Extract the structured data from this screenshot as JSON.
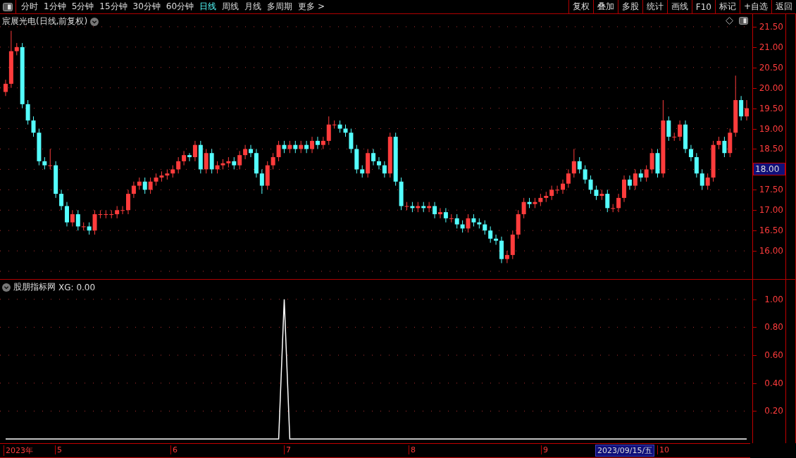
{
  "toolbar": {
    "periods": [
      {
        "label": "分时",
        "selected": false
      },
      {
        "label": "1分钟",
        "selected": false
      },
      {
        "label": "5分钟",
        "selected": false
      },
      {
        "label": "15分钟",
        "selected": false
      },
      {
        "label": "30分钟",
        "selected": false
      },
      {
        "label": "60分钟",
        "selected": false
      },
      {
        "label": "日线",
        "selected": true
      },
      {
        "label": "周线",
        "selected": false
      },
      {
        "label": "月线",
        "selected": false
      },
      {
        "label": "多周期",
        "selected": false
      },
      {
        "label": "更多 >",
        "selected": false
      }
    ],
    "buttons": [
      "复权",
      "叠加",
      "多股",
      "统计",
      "画线",
      "F10",
      "标记",
      "+自选",
      "返回"
    ]
  },
  "main_chart": {
    "title": "宸展光电(日线,前复权)",
    "current_price": "18.00",
    "chart_data": {
      "type": "candlestick",
      "grid": true,
      "ylim": [
        15.31,
        21.81
      ],
      "yticks": [
        {
          "value": 21.5,
          "label": "21.50"
        },
        {
          "value": 21,
          "label": "21.00"
        },
        {
          "value": 20.5,
          "label": "20.50"
        },
        {
          "value": 20,
          "label": "20.00"
        },
        {
          "value": 19.5,
          "label": "19.50"
        },
        {
          "value": 19,
          "label": "19.00"
        },
        {
          "value": 18.5,
          "label": "18.50"
        },
        {
          "value": 17.5,
          "label": "17.50"
        },
        {
          "value": 17,
          "label": "17.00"
        },
        {
          "value": 16.5,
          "label": "16.50"
        },
        {
          "value": 16,
          "label": "16.00"
        }
      ],
      "categories": [
        null,
        null,
        null,
        null,
        null,
        null,
        null,
        null,
        null,
        null,
        null,
        null,
        null,
        null,
        null,
        null,
        null,
        null,
        null,
        null,
        null,
        null,
        null,
        null,
        null,
        null,
        null,
        null,
        null,
        null,
        null,
        null,
        null,
        null,
        null,
        null,
        null,
        null,
        null,
        null,
        null,
        null,
        null,
        null,
        null,
        null,
        null,
        null,
        null,
        null,
        null,
        null,
        null,
        null,
        null,
        null,
        null,
        null,
        null,
        null,
        null,
        null,
        null,
        null,
        null,
        null,
        null,
        null,
        null,
        null,
        null,
        null,
        null,
        null,
        null,
        null,
        null,
        null,
        null,
        null,
        null,
        null,
        null,
        null,
        null,
        null,
        null,
        null,
        null,
        null,
        null,
        null,
        null,
        null,
        null,
        null,
        null,
        null,
        null,
        null,
        null,
        null,
        null,
        null,
        null,
        null,
        null,
        null,
        null,
        null,
        null,
        null,
        null,
        null,
        null,
        null,
        null,
        null,
        null,
        null,
        null,
        null,
        null,
        null,
        null,
        null,
        null,
        null,
        null,
        null,
        null,
        null,
        null,
        null
      ],
      "ohlc": [
        [
          19.9,
          20.2,
          19.8,
          20.1
        ],
        [
          20.1,
          21.4,
          20.0,
          20.9
        ],
        [
          20.9,
          21.1,
          20.8,
          21.0
        ],
        [
          21.0,
          21.1,
          19.5,
          19.6
        ],
        [
          19.6,
          19.7,
          19.1,
          19.2
        ],
        [
          19.2,
          19.3,
          18.8,
          18.9
        ],
        [
          18.9,
          19.0,
          18.1,
          18.2
        ],
        [
          18.2,
          18.3,
          18.0,
          18.1
        ],
        [
          18.1,
          18.5,
          18.0,
          18.1
        ],
        [
          18.1,
          18.2,
          17.3,
          17.4
        ],
        [
          17.4,
          17.5,
          17.0,
          17.1
        ],
        [
          17.1,
          17.2,
          16.6,
          16.7
        ],
        [
          16.7,
          17.0,
          16.6,
          16.9
        ],
        [
          16.9,
          17.0,
          16.5,
          16.6
        ],
        [
          16.6,
          16.7,
          16.5,
          16.6
        ],
        [
          16.6,
          16.7,
          16.4,
          16.5
        ],
        [
          16.5,
          17.0,
          16.4,
          16.9
        ],
        [
          16.9,
          17.0,
          16.8,
          16.9
        ],
        [
          16.9,
          17.0,
          16.8,
          16.9
        ],
        [
          16.9,
          17.0,
          16.8,
          16.9
        ],
        [
          16.9,
          17.1,
          16.8,
          17.0
        ],
        [
          17.0,
          17.1,
          16.9,
          17.0
        ],
        [
          17.0,
          17.5,
          16.9,
          17.4
        ],
        [
          17.4,
          17.7,
          17.3,
          17.6
        ],
        [
          17.6,
          17.8,
          17.5,
          17.7
        ],
        [
          17.7,
          17.8,
          17.4,
          17.5
        ],
        [
          17.5,
          17.8,
          17.4,
          17.7
        ],
        [
          17.7,
          17.9,
          17.6,
          17.8
        ],
        [
          17.8,
          17.95,
          17.7,
          17.85
        ],
        [
          17.85,
          18.0,
          17.75,
          17.9
        ],
        [
          17.9,
          18.1,
          17.8,
          18.0
        ],
        [
          18.0,
          18.3,
          17.9,
          18.2
        ],
        [
          18.2,
          18.45,
          18.1,
          18.35
        ],
        [
          18.35,
          18.4,
          18.2,
          18.3
        ],
        [
          18.3,
          18.7,
          18.2,
          18.6
        ],
        [
          18.6,
          18.7,
          17.9,
          18.0
        ],
        [
          18.0,
          18.5,
          17.9,
          18.4
        ],
        [
          18.4,
          18.5,
          17.9,
          18.0
        ],
        [
          18.0,
          18.2,
          17.9,
          18.1
        ],
        [
          18.1,
          18.25,
          18.0,
          18.15
        ],
        [
          18.15,
          18.3,
          18.05,
          18.2
        ],
        [
          18.2,
          18.3,
          18.0,
          18.1
        ],
        [
          18.1,
          18.45,
          18.0,
          18.35
        ],
        [
          18.35,
          18.6,
          18.25,
          18.5
        ],
        [
          18.5,
          18.6,
          18.3,
          18.4
        ],
        [
          18.4,
          18.5,
          17.8,
          17.9
        ],
        [
          17.9,
          18.0,
          17.4,
          17.6
        ],
        [
          17.6,
          18.2,
          17.5,
          18.1
        ],
        [
          18.1,
          18.4,
          18.0,
          18.3
        ],
        [
          18.3,
          18.7,
          18.2,
          18.6
        ],
        [
          18.6,
          18.7,
          18.4,
          18.5
        ],
        [
          18.5,
          18.7,
          18.4,
          18.6
        ],
        [
          18.6,
          18.7,
          18.4,
          18.5
        ],
        [
          18.5,
          18.7,
          18.4,
          18.6
        ],
        [
          18.6,
          18.7,
          18.4,
          18.5
        ],
        [
          18.5,
          18.8,
          18.4,
          18.7
        ],
        [
          18.7,
          18.8,
          18.5,
          18.6
        ],
        [
          18.6,
          18.8,
          18.5,
          18.7
        ],
        [
          18.7,
          19.3,
          18.6,
          19.1
        ],
        [
          19.1,
          19.2,
          19.0,
          19.1
        ],
        [
          19.1,
          19.2,
          18.9,
          19.0
        ],
        [
          19.0,
          19.1,
          18.8,
          18.9
        ],
        [
          18.9,
          19.0,
          18.4,
          18.5
        ],
        [
          18.5,
          18.6,
          17.9,
          18.0
        ],
        [
          18.0,
          18.1,
          17.8,
          17.9
        ],
        [
          17.9,
          18.5,
          17.8,
          18.4
        ],
        [
          18.4,
          18.5,
          18.1,
          18.2
        ],
        [
          18.2,
          18.3,
          18.0,
          18.1
        ],
        [
          18.1,
          18.2,
          17.8,
          17.9
        ],
        [
          17.9,
          18.9,
          17.8,
          18.8
        ],
        [
          18.8,
          18.9,
          17.6,
          17.7
        ],
        [
          17.7,
          17.8,
          17.0,
          17.1
        ],
        [
          17.1,
          17.2,
          17.0,
          17.1
        ],
        [
          17.1,
          17.2,
          16.95,
          17.05
        ],
        [
          17.05,
          17.2,
          16.95,
          17.1
        ],
        [
          17.1,
          17.2,
          16.95,
          17.05
        ],
        [
          17.05,
          17.2,
          16.95,
          17.1
        ],
        [
          17.1,
          17.2,
          16.8,
          16.9
        ],
        [
          16.9,
          17.05,
          16.8,
          16.95
        ],
        [
          16.95,
          17.05,
          16.7,
          16.8
        ],
        [
          16.8,
          16.9,
          16.7,
          16.8
        ],
        [
          16.8,
          16.9,
          16.55,
          16.65
        ],
        [
          16.65,
          16.75,
          16.45,
          16.55
        ],
        [
          16.55,
          16.9,
          16.45,
          16.8
        ],
        [
          16.8,
          16.9,
          16.6,
          16.7
        ],
        [
          16.7,
          16.8,
          16.55,
          16.65
        ],
        [
          16.65,
          16.75,
          16.4,
          16.5
        ],
        [
          16.5,
          16.6,
          16.2,
          16.3
        ],
        [
          16.3,
          16.4,
          16.15,
          16.25
        ],
        [
          16.25,
          16.35,
          15.7,
          15.8
        ],
        [
          15.8,
          16.0,
          15.7,
          15.9
        ],
        [
          15.9,
          16.5,
          15.8,
          16.4
        ],
        [
          16.4,
          17.0,
          16.3,
          16.9
        ],
        [
          16.9,
          17.3,
          16.8,
          17.2
        ],
        [
          17.2,
          17.3,
          17.05,
          17.15
        ],
        [
          17.15,
          17.3,
          17.05,
          17.2
        ],
        [
          17.2,
          17.4,
          17.1,
          17.3
        ],
        [
          17.3,
          17.45,
          17.2,
          17.35
        ],
        [
          17.35,
          17.6,
          17.25,
          17.5
        ],
        [
          17.5,
          17.6,
          17.4,
          17.5
        ],
        [
          17.5,
          17.75,
          17.4,
          17.65
        ],
        [
          17.65,
          18.0,
          17.55,
          17.9
        ],
        [
          17.9,
          18.5,
          17.8,
          18.2
        ],
        [
          18.2,
          18.3,
          17.9,
          18.0
        ],
        [
          18.0,
          18.1,
          17.65,
          17.75
        ],
        [
          17.75,
          17.85,
          17.4,
          17.5
        ],
        [
          17.5,
          17.6,
          17.25,
          17.35
        ],
        [
          17.35,
          17.5,
          17.25,
          17.4
        ],
        [
          17.4,
          17.5,
          16.95,
          17.05
        ],
        [
          17.05,
          17.15,
          16.95,
          17.05
        ],
        [
          17.05,
          17.4,
          16.95,
          17.3
        ],
        [
          17.3,
          17.85,
          17.2,
          17.75
        ],
        [
          17.75,
          17.85,
          17.5,
          17.6
        ],
        [
          17.6,
          18.0,
          17.5,
          17.9
        ],
        [
          17.9,
          18.0,
          17.7,
          17.8
        ],
        [
          17.8,
          18.1,
          17.7,
          18.0
        ],
        [
          18.0,
          18.5,
          17.9,
          18.4
        ],
        [
          18.4,
          18.5,
          17.8,
          17.9
        ],
        [
          17.9,
          19.7,
          17.8,
          19.2
        ],
        [
          19.2,
          19.3,
          18.7,
          18.8
        ],
        [
          18.8,
          18.9,
          18.7,
          18.8
        ],
        [
          18.8,
          19.2,
          18.7,
          19.1
        ],
        [
          19.1,
          19.2,
          18.4,
          18.5
        ],
        [
          18.5,
          18.6,
          18.2,
          18.3
        ],
        [
          18.3,
          18.4,
          17.8,
          17.9
        ],
        [
          17.9,
          18.0,
          17.5,
          17.6
        ],
        [
          17.6,
          17.9,
          17.5,
          17.8
        ],
        [
          17.8,
          18.7,
          17.7,
          18.6
        ],
        [
          18.6,
          18.8,
          18.5,
          18.7
        ],
        [
          18.7,
          18.8,
          18.3,
          18.4
        ],
        [
          18.4,
          19.0,
          18.3,
          18.9
        ],
        [
          18.9,
          20.3,
          18.8,
          19.7
        ],
        [
          19.7,
          19.8,
          19.2,
          19.3
        ],
        [
          19.3,
          19.7,
          19.2,
          19.5
        ]
      ]
    }
  },
  "indicator": {
    "title": "股朋指标网",
    "reading": ": 0.00",
    "chart_data": {
      "type": "line",
      "categories": [
        null,
        null,
        null,
        null,
        null,
        null,
        null,
        null,
        null,
        null,
        null,
        null,
        null,
        null,
        null,
        null,
        null,
        null,
        null,
        null,
        null,
        null,
        null,
        null,
        null,
        null,
        null,
        null,
        null,
        null,
        null,
        null,
        null,
        null,
        null,
        null,
        null,
        null,
        null,
        null,
        null,
        null,
        null,
        null,
        null,
        null,
        null,
        null,
        null,
        null,
        null,
        null,
        null,
        null,
        null,
        null,
        null,
        null,
        null,
        null,
        null,
        null,
        null,
        null,
        null,
        null,
        null,
        null,
        null,
        null,
        null,
        null,
        null,
        null,
        null,
        null,
        null,
        null,
        null,
        null,
        null,
        null,
        null,
        null,
        null,
        null,
        null,
        null,
        null,
        null,
        null,
        null,
        null,
        null,
        null,
        null,
        null,
        null,
        null,
        null,
        null,
        null,
        null,
        null,
        null,
        null,
        null,
        null,
        null,
        null,
        null,
        null,
        null,
        null,
        null,
        null,
        null,
        null,
        null,
        null,
        null,
        null,
        null,
        null,
        null,
        null,
        null,
        null,
        null,
        null,
        null,
        null,
        null,
        null
      ],
      "series": [
        {
          "name": "XG",
          "color": "#ffffff",
          "values": [
            0,
            0,
            0,
            0,
            0,
            0,
            0,
            0,
            0,
            0,
            0,
            0,
            0,
            0,
            0,
            0,
            0,
            0,
            0,
            0,
            0,
            0,
            0,
            0,
            0,
            0,
            0,
            0,
            0,
            0,
            0,
            0,
            0,
            0,
            0,
            0,
            0,
            0,
            0,
            0,
            0,
            0,
            0,
            0,
            0,
            0,
            0,
            0,
            0,
            0,
            1,
            0,
            0,
            0,
            0,
            0,
            0,
            0,
            0,
            0,
            0,
            0,
            0,
            0,
            0,
            0,
            0,
            0,
            0,
            0,
            0,
            0,
            0,
            0,
            0,
            0,
            0,
            0,
            0,
            0,
            0,
            0,
            0,
            0,
            0,
            0,
            0,
            0,
            0,
            0,
            0,
            0,
            0,
            0,
            0,
            0,
            0,
            0,
            0,
            0,
            0,
            0,
            0,
            0,
            0,
            0,
            0,
            0,
            0,
            0,
            0,
            0,
            0,
            0,
            0,
            0,
            0,
            0,
            0,
            0,
            0,
            0,
            0,
            0,
            0,
            0,
            0,
            0,
            0,
            0,
            0,
            0,
            0,
            0
          ]
        }
      ],
      "grid": true,
      "ylim": [
        -0.03,
        1.14
      ],
      "yticks": [
        {
          "value": 0.2,
          "label": "0.20"
        },
        {
          "value": 0.4,
          "label": "0.40"
        },
        {
          "value": 0.6,
          "label": "0.60"
        },
        {
          "value": 0.8,
          "label": "0.80"
        },
        {
          "value": 1,
          "label": "1.00"
        }
      ]
    }
  },
  "date_axis": {
    "labels": [
      "2023年",
      "5",
      "6",
      "7",
      "8",
      "9",
      "10"
    ],
    "cursor_date": "2023/09/15/五"
  }
}
